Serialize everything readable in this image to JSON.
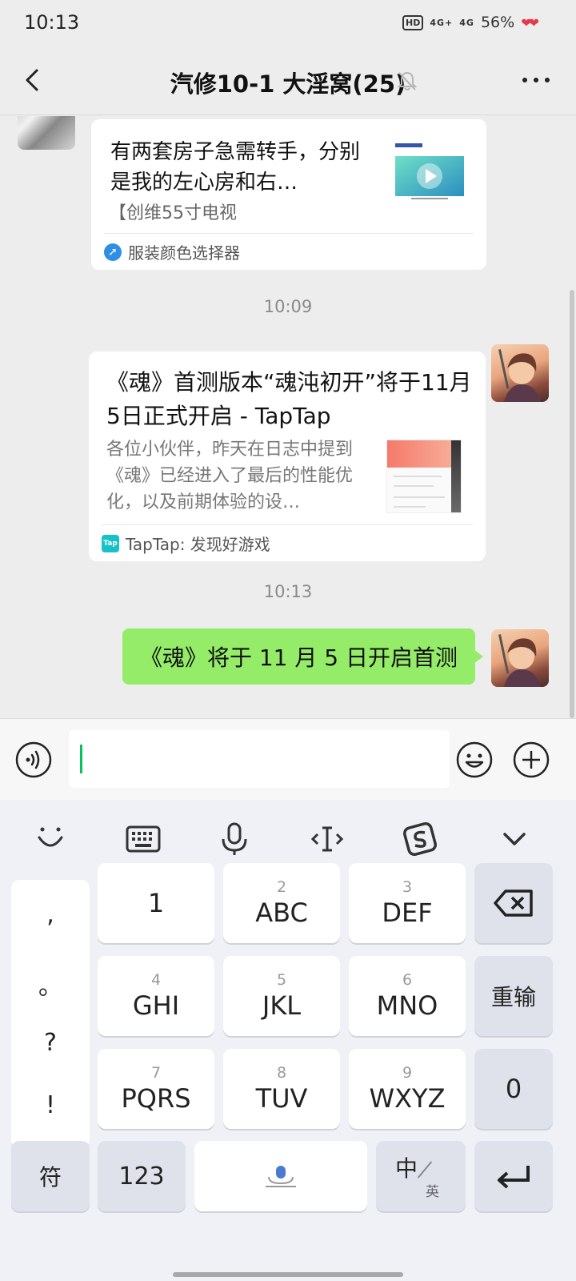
{
  "status_bar": {
    "time": "10:13",
    "hd": "HD",
    "network_1": "4G+",
    "network_2": "4G",
    "battery": "56%"
  },
  "nav": {
    "title": "汽修10-1 大淫窝(25)"
  },
  "messages": {
    "card1": {
      "title": "有两套房子急需转手，分别是我的左心房和右…",
      "subtitle": "【创维55寸电视",
      "source": "服装颜色选择器"
    },
    "time1": "10:09",
    "card2": {
      "title": "《魂》首测版本“魂沌初开”将于11月5日正式开启 - TapTap",
      "description": "各位小伙伴，昨天在日志中提到《魂》已经进入了最后的性能优化，以及前期体验的设…",
      "source": "TapTap: 发现好游戏",
      "source_icon_text": "Tap"
    },
    "time2": "10:13",
    "my_message": "《魂》将于 11 月 5 日开启首测"
  },
  "keyboard": {
    "punctuation": [
      ",",
      "。",
      "?",
      "!"
    ],
    "keys": [
      {
        "num": "",
        "label": "1"
      },
      {
        "num": "2",
        "label": "ABC"
      },
      {
        "num": "3",
        "label": "DEF"
      },
      {
        "num": "4",
        "label": "GHI"
      },
      {
        "num": "5",
        "label": "JKL"
      },
      {
        "num": "6",
        "label": "MNO"
      },
      {
        "num": "7",
        "label": "PQRS"
      },
      {
        "num": "8",
        "label": "TUV"
      },
      {
        "num": "9",
        "label": "WXYZ"
      }
    ],
    "reset_label": "重输",
    "zero_label": "0",
    "symbol_label": "符",
    "num_label": "123",
    "lang_main": "中",
    "lang_sub": "英"
  },
  "colors": {
    "my_bubble": "#95ec69",
    "caret": "#07c160",
    "background": "#ededed"
  }
}
